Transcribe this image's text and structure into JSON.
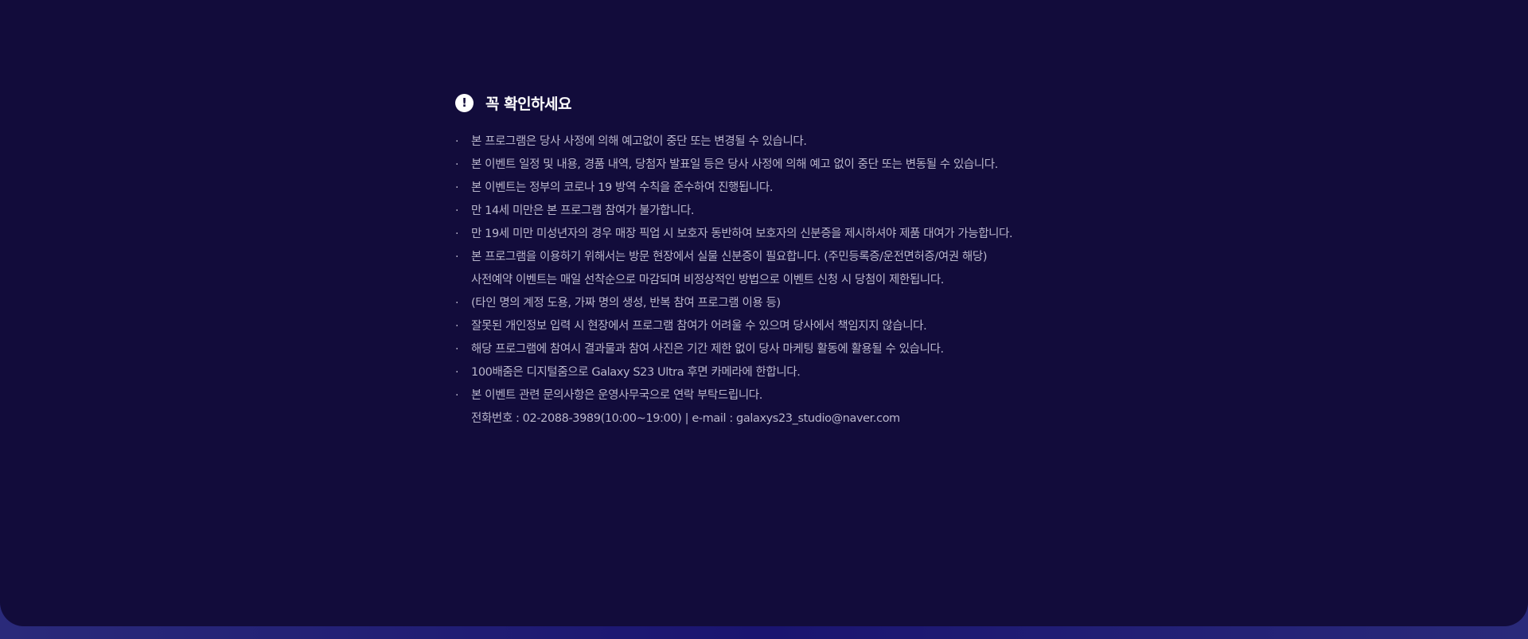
{
  "notice": {
    "title": "꼭 확인하세요",
    "icon": "exclamation-icon",
    "items": [
      {
        "text": "본 프로그램은 당사 사정에 의해 예고없이 중단 또는 변경될 수 있습니다.",
        "bullet": true
      },
      {
        "text": "본 이벤트 일정 및 내용, 경품 내역, 당첨자 발표일 등은 당사 사정에 의해 예고 없이 중단 또는 변동될 수 있습니다.",
        "bullet": true
      },
      {
        "text": "본 이벤트는 정부의 코로나 19 방역 수칙을 준수하여 진행됩니다.",
        "bullet": true
      },
      {
        "text": "만 14세 미만은 본 프로그램 참여가 불가합니다.",
        "bullet": true
      },
      {
        "text": "만 19세 미만 미성년자의 경우 매장 픽업 시 보호자 동반하여 보호자의 신분증을 제시하셔야 제품 대여가 가능합니다.",
        "bullet": true
      },
      {
        "text": "본 프로그램을 이용하기 위해서는 방문 현장에서 실물 신분증이 필요합니다. (주민등록증/운전면허증/여권 해당)",
        "bullet": true
      },
      {
        "text": "사전예약 이벤트는 매일 선착순으로 마감되며 비정상적인 방법으로 이벤트 신청 시 당첨이 제한됩니다.",
        "bullet": false
      },
      {
        "text": "(타인 명의 계정 도용, 가짜 명의 생성, 반복 참여 프로그램 이용 등)",
        "bullet": true
      },
      {
        "text": "잘못된 개인정보 입력 시 현장에서 프로그램 참여가 어려울 수 있으며 당사에서 책임지지 않습니다.",
        "bullet": true
      },
      {
        "text": "해당 프로그램에 참여시 결과물과 참여 사진은 기간 제한 없이 당사 마케팅 활동에 활용될 수 있습니다.",
        "bullet": true
      },
      {
        "text": "100배줌은 디지털줌으로 Galaxy S23 Ultra 후면 카메라에 한합니다.",
        "bullet": true
      },
      {
        "text": "본 이벤트 관련 문의사항은 운영사무국으로 연락 부탁드립니다.",
        "bullet": true
      },
      {
        "text": "전화번호 : 02-2088-3989(10:00~19:00) | e-mail : galaxys23_studio@naver.com",
        "bullet": false
      }
    ]
  }
}
